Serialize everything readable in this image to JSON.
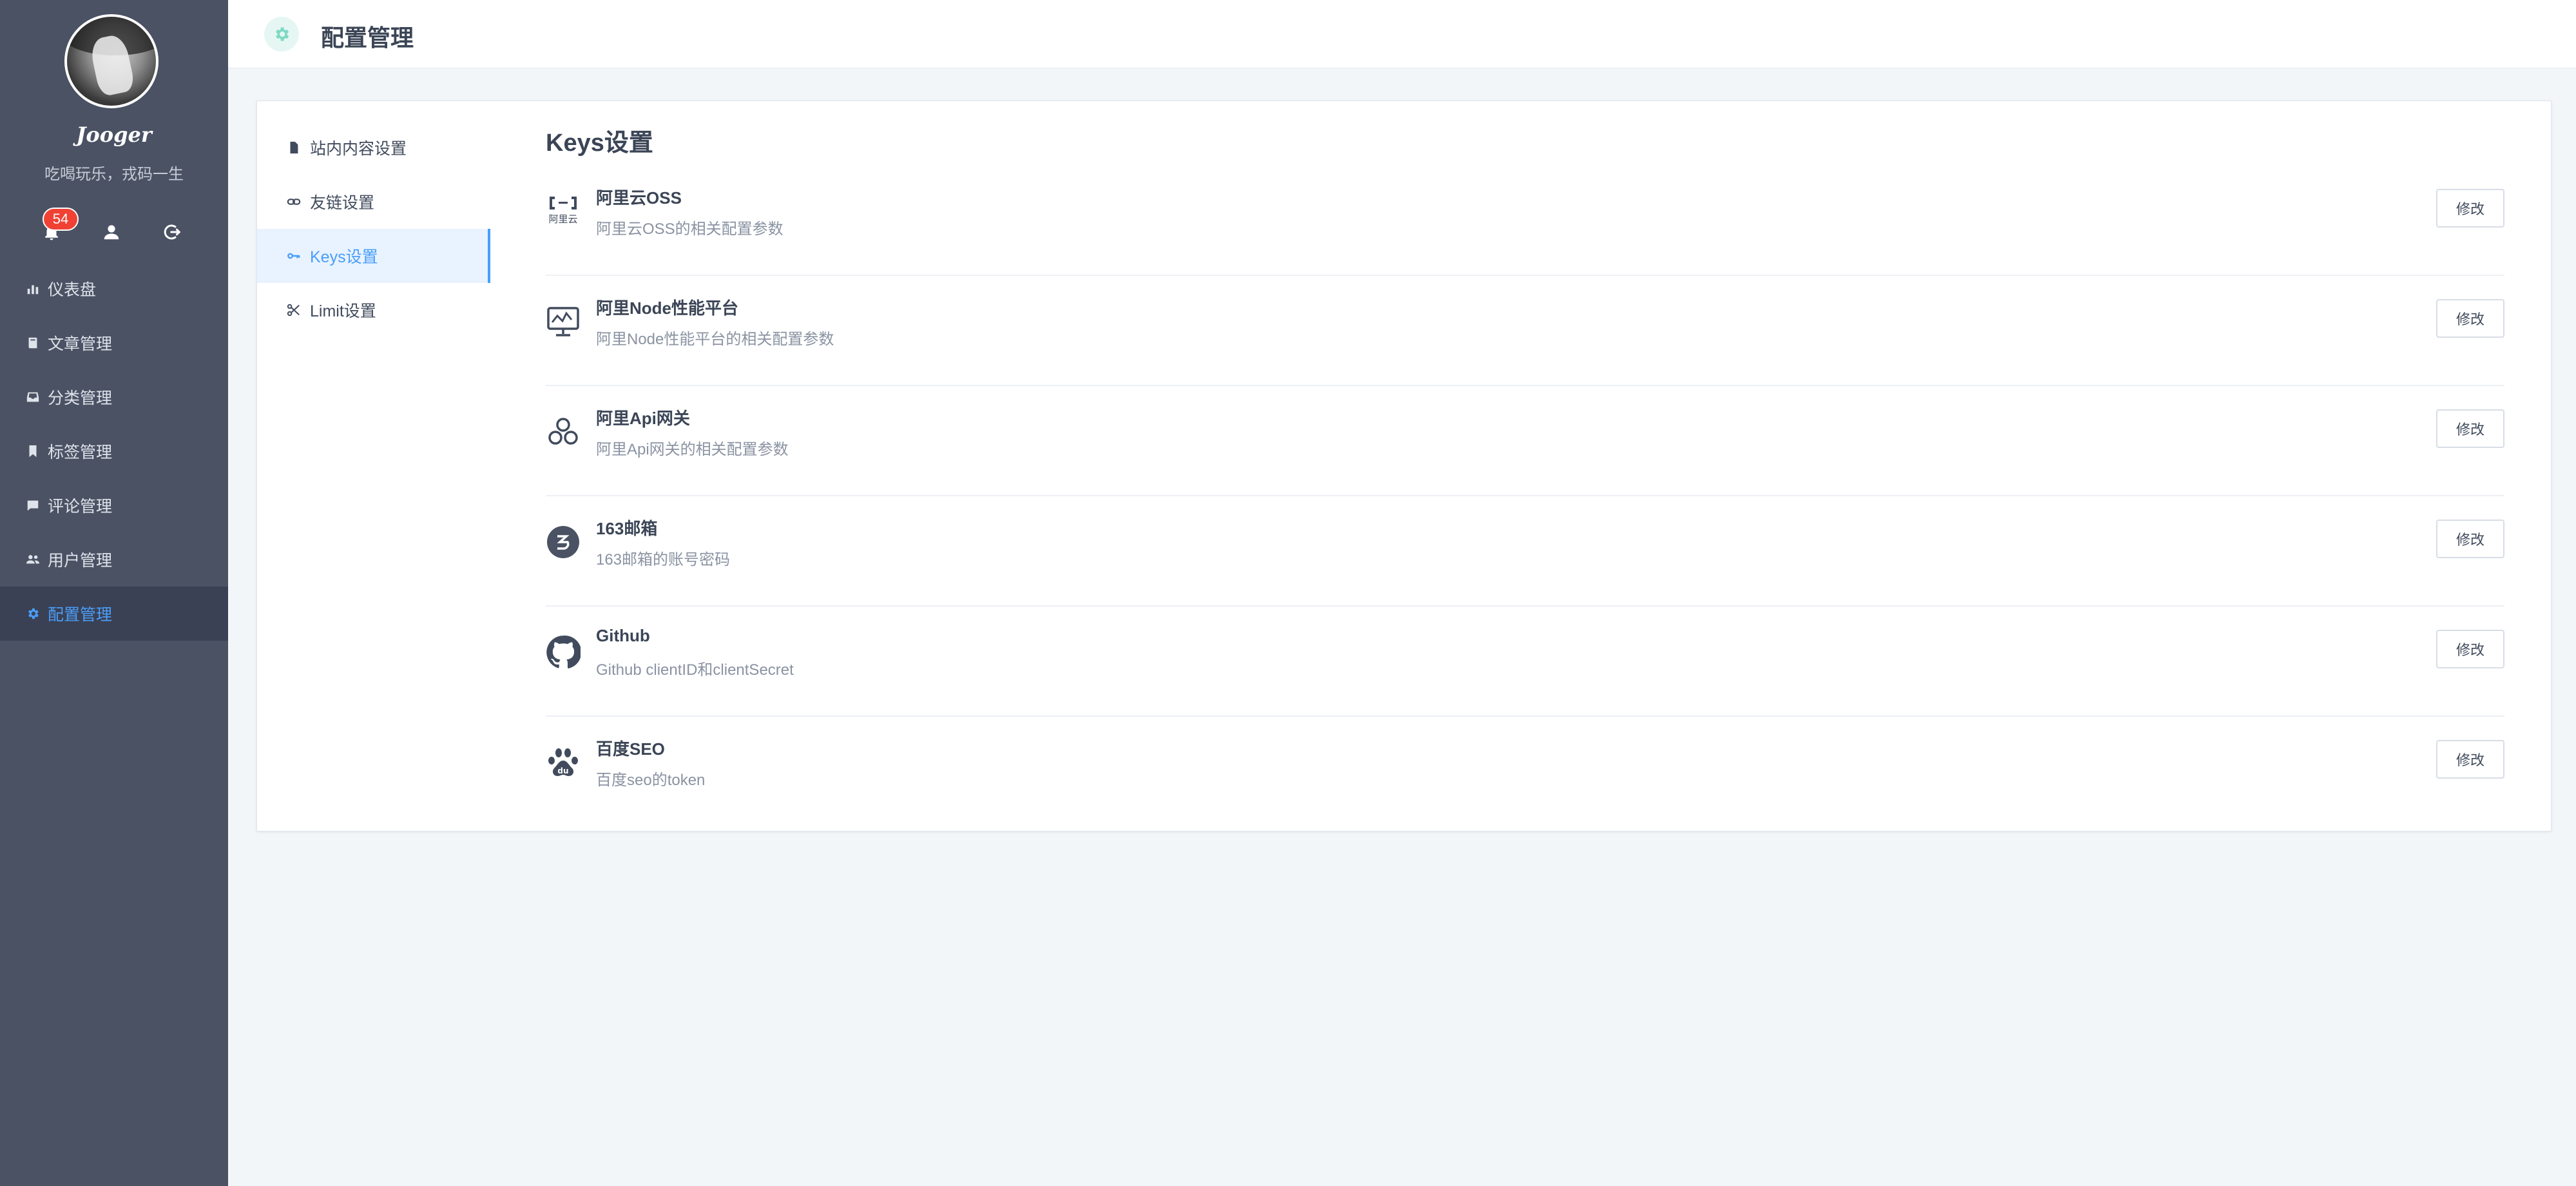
{
  "sidebar": {
    "username": "Jooger",
    "motto": "吃喝玩乐，戎码一生",
    "notification_count": "54",
    "nav": [
      {
        "label": "仪表盘",
        "icon": "bar-chart-icon"
      },
      {
        "label": "文章管理",
        "icon": "book-icon"
      },
      {
        "label": "分类管理",
        "icon": "inbox-icon"
      },
      {
        "label": "标签管理",
        "icon": "bookmark-icon"
      },
      {
        "label": "评论管理",
        "icon": "comment-icon"
      },
      {
        "label": "用户管理",
        "icon": "users-icon"
      },
      {
        "label": "配置管理",
        "icon": "gear-icon",
        "active": true
      }
    ]
  },
  "header": {
    "title": "配置管理"
  },
  "submenu": [
    {
      "label": "站内内容设置",
      "icon": "file-icon"
    },
    {
      "label": "友链设置",
      "icon": "link-icon"
    },
    {
      "label": "Keys设置",
      "icon": "key-icon",
      "active": true
    },
    {
      "label": "Limit设置",
      "icon": "scissors-icon"
    }
  ],
  "content": {
    "title": "Keys设置",
    "edit_label": "修改",
    "items": [
      {
        "name": "阿里云OSS",
        "desc": "阿里云OSS的相关配置参数",
        "icon": "aliyun-icon"
      },
      {
        "name": "阿里Node性能平台",
        "desc": "阿里Node性能平台的相关配置参数",
        "icon": "monitor-icon"
      },
      {
        "name": "阿里Api网关",
        "desc": "阿里Api网关的相关配置参数",
        "icon": "api-gateway-icon"
      },
      {
        "name": "163邮箱",
        "desc": "163邮箱的账号密码",
        "icon": "mail163-icon"
      },
      {
        "name": "Github",
        "desc": "Github clientID和clientSecret",
        "icon": "github-icon"
      },
      {
        "name": "百度SEO",
        "desc": "百度seo的token",
        "icon": "baidu-icon"
      }
    ]
  },
  "colors": {
    "sidebar_bg": "#4a5264",
    "accent": "#4a9df8",
    "badge": "#f04134"
  }
}
